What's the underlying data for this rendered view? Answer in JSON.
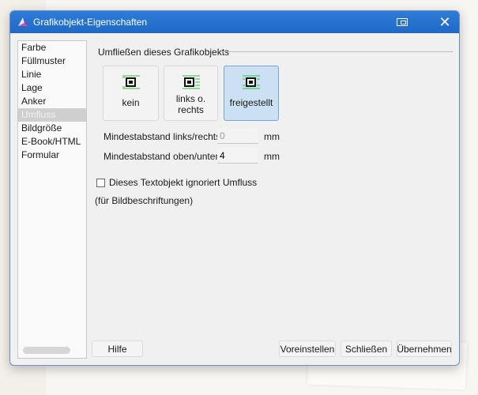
{
  "window": {
    "title": "Grafikobjekt-Eigenschaften",
    "close_glyph": "✕"
  },
  "sidebar": {
    "items": [
      {
        "label": "Farbe",
        "selected": false
      },
      {
        "label": "Füllmuster",
        "selected": false
      },
      {
        "label": "Linie",
        "selected": false
      },
      {
        "label": "Lage",
        "selected": false
      },
      {
        "label": "Anker",
        "selected": false
      },
      {
        "label": "Umfluss",
        "selected": true
      },
      {
        "label": "Bildgröße",
        "selected": false
      },
      {
        "label": "E-Book/HTML",
        "selected": false
      },
      {
        "label": "Formular",
        "selected": false
      }
    ]
  },
  "wrap": {
    "group_title": "Umfließen dieses Grafikobjekts",
    "options": [
      {
        "label": "kein",
        "active": false,
        "icon": "wrap-none-icon"
      },
      {
        "label": "links o. rechts",
        "active": false,
        "icon": "wrap-left-right-icon"
      },
      {
        "label": "freigestellt",
        "active": true,
        "icon": "wrap-around-icon"
      }
    ]
  },
  "fields": {
    "horizontal_label": "Mindestabstand links/rechts",
    "horizontal_value": "0",
    "horizontal_unit": "mm",
    "vertical_label": "Mindestabstand oben/unten",
    "vertical_value": "4",
    "vertical_unit": "mm"
  },
  "checkbox": {
    "label": "Dieses Textobjekt ignoriert Umfluss",
    "checked": false
  },
  "note": "(für Bildbeschriftungen)",
  "buttons": {
    "help": "Hilfe",
    "reset": "Voreinstellen",
    "close": "Schließen",
    "apply": "Übernehmen"
  },
  "colors": {
    "titlebar": "#1f6ac7",
    "active_option": "#cce0f3",
    "icon_green": "#2fbf3f"
  }
}
